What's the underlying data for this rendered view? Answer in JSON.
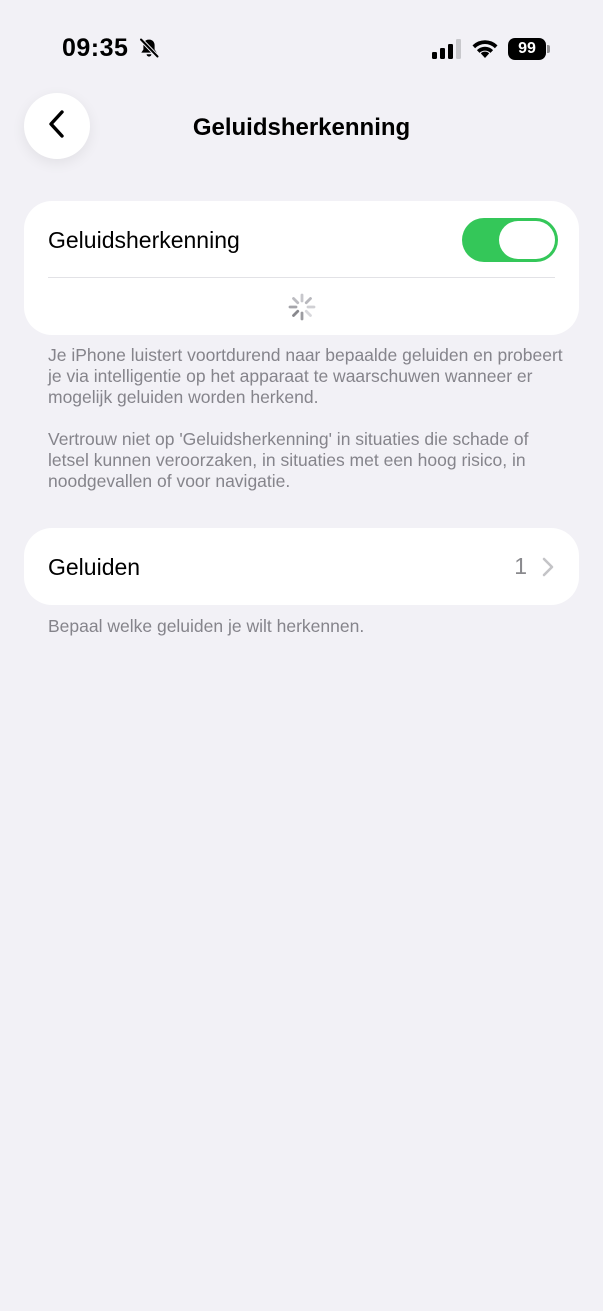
{
  "status_bar": {
    "time": "09:35",
    "battery": "99",
    "icons": [
      "bell-slash-icon",
      "cellular-signal-icon",
      "wifi-icon",
      "battery-icon"
    ]
  },
  "nav": {
    "title": "Geluidsherkenning",
    "back_icon": "chevron-left-icon"
  },
  "sound_recognition": {
    "label": "Geluidsherkenning",
    "enabled": true,
    "toggle_color": "#34c759",
    "loading_icon": "activity-spinner-icon"
  },
  "footer": {
    "paragraph1": "Je iPhone luistert voortdurend naar bepaalde geluiden en probeert je via intelligentie op het apparaat te waarschuwen wanneer er mogelijk geluiden worden herkend.",
    "paragraph2": "Vertrouw niet op 'Geluidsherkenning' in situaties die schade of letsel kunnen veroorzaken, in situaties met een hoog risico, in noodgevallen of voor navigatie."
  },
  "sounds": {
    "label": "Geluiden",
    "value": "1",
    "footer": "Bepaal welke geluiden je wilt herkennen."
  }
}
